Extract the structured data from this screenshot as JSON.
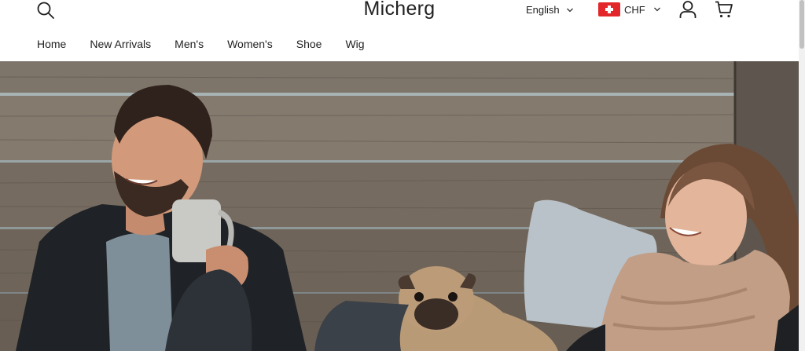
{
  "header": {
    "logo": "Micherg",
    "language": "English",
    "currency": "CHF",
    "icons": {
      "search": "search-icon",
      "account": "user-icon",
      "cart": "cart-icon",
      "flag": "swiss-flag-icon"
    }
  },
  "nav": {
    "items": [
      "Home",
      "New Arrivals",
      "Men's",
      "Women's",
      "Shoe",
      "Wig"
    ]
  },
  "hero": {
    "image": "couple-with-pug-hero-image"
  },
  "colors": {
    "text": "#222222",
    "flag_red": "#e3262a",
    "background": "#ffffff"
  }
}
